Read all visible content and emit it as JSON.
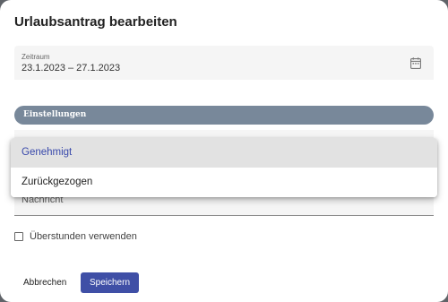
{
  "dialog": {
    "title": "Urlaubsantrag bearbeiten"
  },
  "period": {
    "label": "Zeitraum",
    "value": "23.1.2023 – 27.1.2023",
    "icon": "calendar-icon"
  },
  "settings": {
    "label": "Einstellungen"
  },
  "status_dropdown": {
    "options": [
      {
        "label": "Genehmigt",
        "selected": true
      },
      {
        "label": "Zurückgezogen",
        "selected": false
      }
    ]
  },
  "message": {
    "placeholder": "Nachricht"
  },
  "overtime": {
    "label": "Überstunden verwenden",
    "checked": false
  },
  "actions": {
    "cancel_label": "Abbrechen",
    "save_label": "Speichern"
  },
  "colors": {
    "primary": "#3f4fa6",
    "settings_bar": "#78889a",
    "selected_option_text": "#3949ab"
  }
}
